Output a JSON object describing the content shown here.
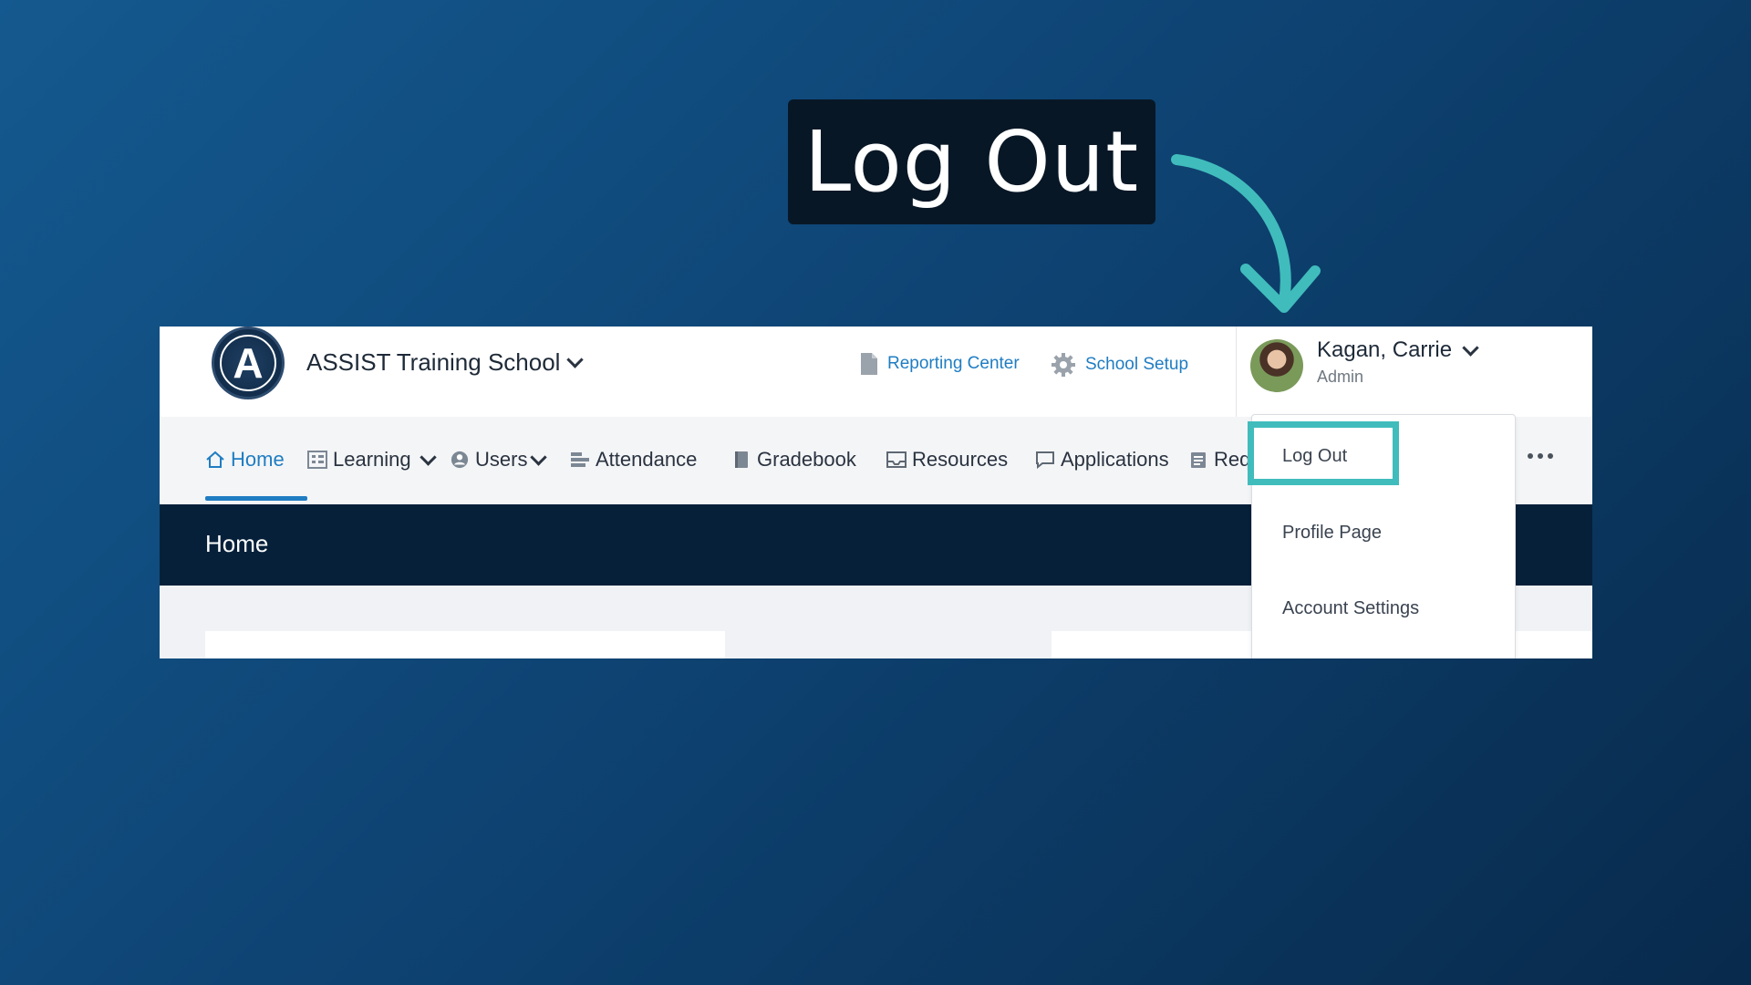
{
  "callout": {
    "title": "Log Out"
  },
  "header": {
    "school_name": "ASSIST Training School",
    "reporting_center": "Reporting Center",
    "school_setup": "School Setup",
    "user_name": "Kagan, Carrie",
    "user_role": "Admin"
  },
  "nav": {
    "items": [
      {
        "label": "Home"
      },
      {
        "label": "Learning"
      },
      {
        "label": "Users"
      },
      {
        "label": "Attendance"
      },
      {
        "label": "Gradebook"
      },
      {
        "label": "Resources"
      },
      {
        "label": "Applications"
      },
      {
        "label": "Req"
      }
    ]
  },
  "breadcrumb": {
    "title": "Home"
  },
  "user_menu": {
    "items": [
      {
        "label": "Log Out"
      },
      {
        "label": "Profile Page"
      },
      {
        "label": "Account Settings"
      }
    ]
  },
  "colors": {
    "accent": "#1f7dc2",
    "highlight": "#40bcbc",
    "header_dark": "#06203a",
    "background": "#0e4474"
  },
  "icons": {
    "home": "home-icon",
    "learning": "grid-icon",
    "users": "user-circle-icon",
    "attendance": "bars-icon",
    "gradebook": "book-icon",
    "resources": "inbox-icon",
    "applications": "chat-icon",
    "requests": "clipboard-icon",
    "reporting": "document-icon",
    "setup": "gear-icon",
    "more": "more-horizontal-icon"
  }
}
